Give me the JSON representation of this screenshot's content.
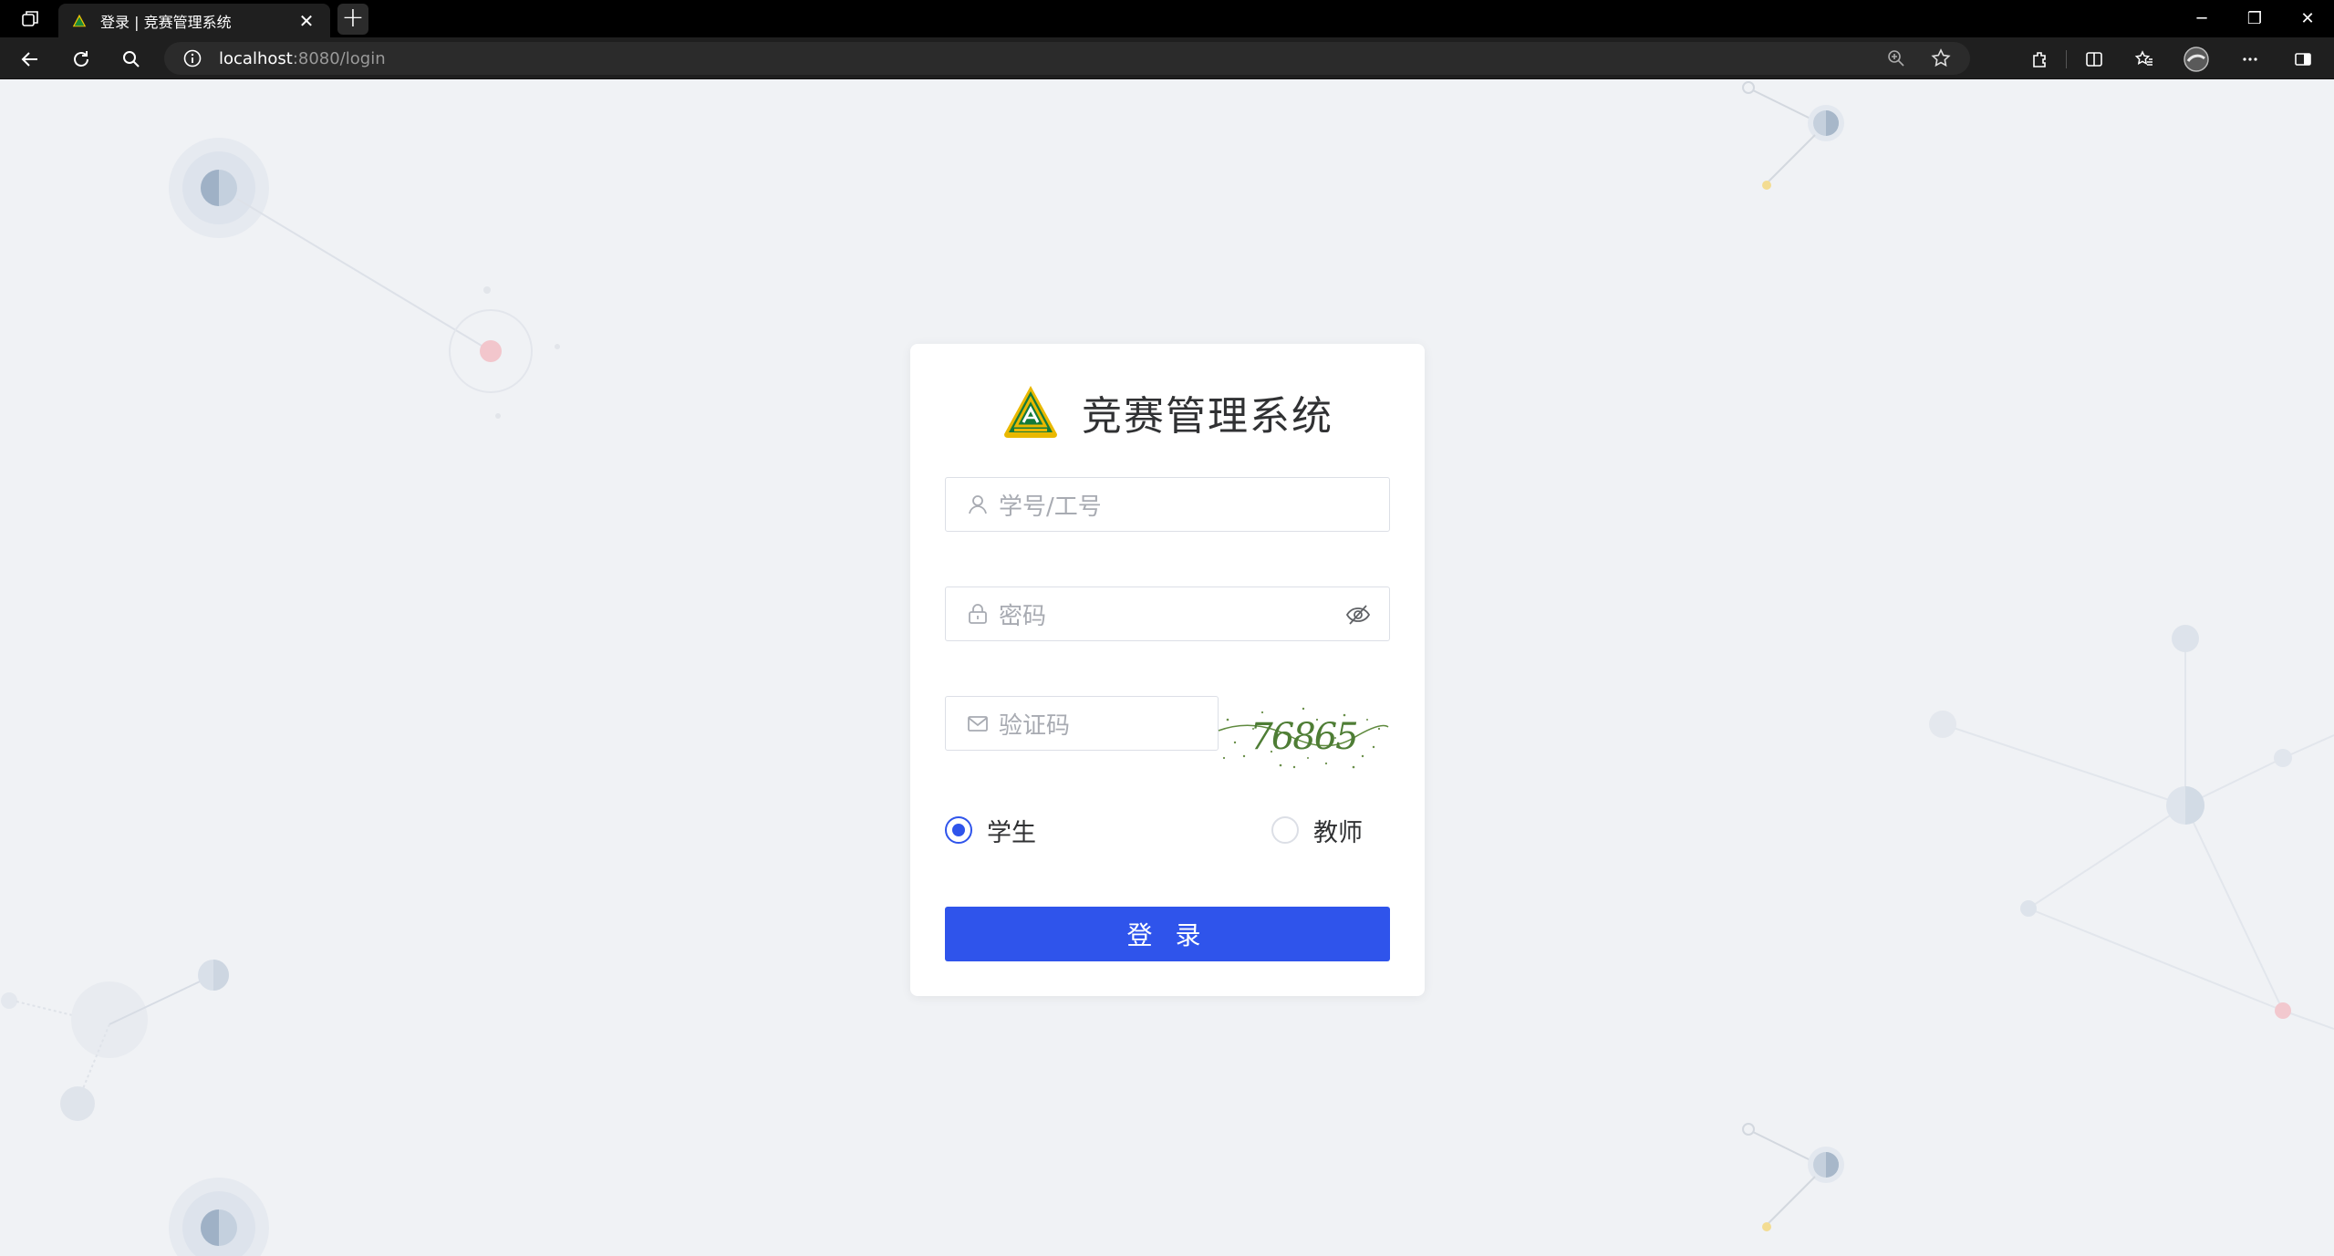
{
  "browser": {
    "tab_title": "登录 | 竞赛管理系统",
    "tab_close": "✕",
    "new_tab": "+",
    "url_host": "localhost",
    "url_rest": ":8080/login",
    "window_controls": [
      "─",
      "❐",
      "✕"
    ]
  },
  "login": {
    "system_name": "竞赛管理系统",
    "username_placeholder": "学号/工号",
    "password_placeholder": "密码",
    "captcha_placeholder": "验证码",
    "captcha_text": "76865",
    "roles": [
      {
        "label": "学生",
        "checked": true
      },
      {
        "label": "教师",
        "checked": false
      }
    ],
    "submit_label": "登 录"
  },
  "colors": {
    "primary": "#2f54eb",
    "page_bg": "#f0f2f5",
    "placeholder": "#a8abb2",
    "border": "#dcdfe6"
  }
}
